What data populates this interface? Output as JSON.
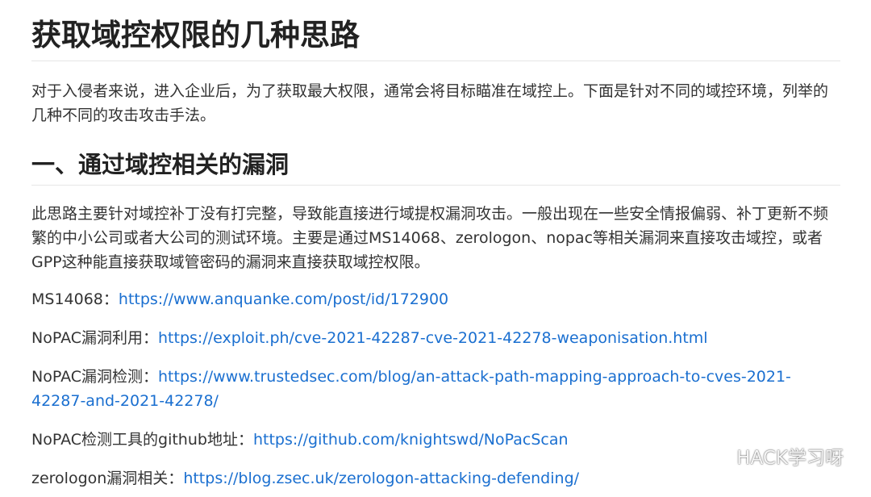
{
  "title": "获取域控权限的几种思路",
  "intro": "对于入侵者来说，进入企业后，为了获取最大权限，通常会将目标瞄准在域控上。下面是针对不同的域控环境，列举的几种不同的攻击攻击手法。",
  "section1": {
    "heading": "一、通过域控相关的漏洞",
    "paragraph": "此思路主要针对域控补丁没有打完整，导致能直接进行域提权漏洞攻击。一般出现在一些安全情报偏弱、补丁更新不频繁的中小公司或者大公司的测试环境。主要是通过MS14068、zerologon、nopac等相关漏洞来直接攻击域控，或者GPP这种能直接获取域管密码的漏洞来直接获取域控权限。"
  },
  "links": [
    {
      "label": "MS14068：",
      "url": "https://www.anquanke.com/post/id/172900"
    },
    {
      "label": "NoPAC漏洞利用：",
      "url": "https://exploit.ph/cve-2021-42287-cve-2021-42278-weaponisation.html"
    },
    {
      "label": "NoPAC漏洞检测：",
      "url": "https://www.trustedsec.com/blog/an-attack-path-mapping-approach-to-cves-2021-42287-and-2021-42278/"
    },
    {
      "label": "NoPAC检测工具的github地址：",
      "url": "https://github.com/knightswd/NoPacScan"
    },
    {
      "label": "zerologon漏洞相关：",
      "url": "https://blog.zsec.uk/zerologon-attacking-defending/"
    }
  ],
  "watermark": {
    "text": "HACK学习呀",
    "icon": "wechat-icon"
  }
}
